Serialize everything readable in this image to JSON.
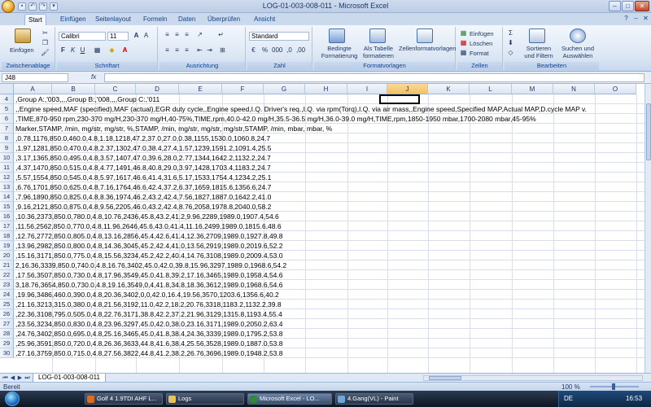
{
  "window": {
    "title": "LOG-01-003-008-011 - Microsoft Excel"
  },
  "tabs": [
    "Start",
    "Einfügen",
    "Seitenlayout",
    "Formeln",
    "Daten",
    "Überprüfen",
    "Ansicht"
  ],
  "ribbon": {
    "clipboard": {
      "label": "Zwischenablage",
      "paste": "Einfügen"
    },
    "font": {
      "label": "Schriftart",
      "name": "Calibri",
      "size": "11"
    },
    "alignment": {
      "label": "Ausrichtung"
    },
    "number": {
      "label": "Zahl",
      "format": "Standard"
    },
    "styles": {
      "label": "Formatvorlagen",
      "conditional": "Bedingte Formatierung",
      "as_table": "Als Tabelle formatieren",
      "cell_styles": "Zellenformatvorlagen"
    },
    "cells": {
      "label": "Zellen",
      "insert": "Einfügen",
      "delete": "Löschen",
      "format": "Format"
    },
    "editing": {
      "label": "Bearbeiten",
      "sort": "Sortieren und Filtern",
      "find": "Suchen und Auswählen"
    }
  },
  "formula_bar": {
    "name_box": "J48",
    "fx": "fx",
    "value": ""
  },
  "columns": [
    "A",
    "B",
    "C",
    "D",
    "E",
    "F",
    "G",
    "H",
    "I",
    "J",
    "K",
    "L",
    "M",
    "N",
    "O"
  ],
  "rows": [
    {
      "n": "4",
      "text": ",Group A:,'003,,,,Group B:,'008,,,,Group C:,'011"
    },
    {
      "n": "5",
      "text": ",,Engine speed,MAF (specified),MAF (actual),EGR duty cycle,,Engine speed,I.Q. Driver's req.,I.Q. via rpm(Torq),I.Q. via air mass,,Engine speed,Specified MAP,Actual MAP,D.cycle MAP v."
    },
    {
      "n": "6",
      "text": ",TIME,870-950 rpm,230-370 mg/H,230-370 mg/H,40-75%,TIME,rpm,40.0-42.0 mg/H,35.5-36.5 mg/H,36.0-39.0 mg/H,TIME,rpm,1850-1950 mbar,1700-2080 mbar,45-95%"
    },
    {
      "n": "7",
      "text": "Marker,STAMP, /min, mg/str, mg/str, %,STAMP, /min, mg/str, mg/str, mg/str,STAMP, /min, mbar, mbar, %"
    },
    {
      "n": "8",
      "text": ",0.78,1176,850.0,460.0,4.8,1.18,1218,47.2,37.0,27.0,0.38,1155,1530.0,1060.8,24.7"
    },
    {
      "n": "9",
      "text": ",1.97,1281,850.0,470.0,4.8,2.37,1302,47.0,38.4,27.4,1.57,1239,1591.2,1091.4,25.5"
    },
    {
      "n": "10",
      "text": ",3.17,1365,850.0,495.0,4.8,3.57,1407,47.0,39.6,28.0,2.77,1344,1642.2,1132.2,24.7"
    },
    {
      "n": "11",
      "text": ",4.37,1470,850.0,515.0,4.8,4.77,1491,46.8,40.8,29.0,3.97,1428,1703.4,1183.2,24.7"
    },
    {
      "n": "12",
      "text": ",5.57,1554,850.0,545.0,4.8,5.97,1617,46.6,41.4,31.6,5.17,1533,1754.4,1234.2,25.1"
    },
    {
      "n": "13",
      "text": ",6.76,1701,850.0,625.0,4.8,7.16,1764,46.6,42.4,37.2,6.37,1659,1815.6,1356.6,24.7"
    },
    {
      "n": "14",
      "text": ",7.96,1890,850.0,825.0,4.8,8.36,1974,46.2,43.2,42.4,7.56,1827,1887.0,1642.2,41.0"
    },
    {
      "n": "15",
      "text": ",9.16,2121,850.0,875.0,4.8,9.56,2205,46.0,43.2,42.4,8.76,2058,1978.8,2040.0,58.2"
    },
    {
      "n": "16",
      "text": ",10.36,2373,850.0,780.0,4.8,10.76,2436,45.8,43.2,41.2,9.96,2289,1989.0,1907.4,54.6"
    },
    {
      "n": "17",
      "text": ",11.56,2562,850.0,770.0,4.8,11.96,2646,45.6,43.0,41.4,11.16,2499,1989.0,1815.6,48.6"
    },
    {
      "n": "18",
      "text": ",12.76,2772,850.0,805.0,4.8,13.16,2856,45.4,42.6,41.4,12.36,2709,1989.0,1927.8,49.8"
    },
    {
      "n": "19",
      "text": ",13.96,2982,850.0,800.0,4.8,14.36,3045,45.2,42.4,41.0,13.56,2919,1989.0,2019.6,52.2"
    },
    {
      "n": "20",
      "text": ",15.16,3171,850.0,775.0,4.8,15.56,3234,45.2,42.2,40.4,14.76,3108,1989.0,2009.4,53.0"
    },
    {
      "n": "21",
      "text": "2,16.36,3339,850.0,740.0,4.8,16.76,3402,45.0,42.0,39.8,15.96,3297,1989.0,1968.6,54.2"
    },
    {
      "n": "22",
      "text": ",17.56,3507,850.0,730.0,4.8,17.96,3549,45.0,41.8,39.2,17.16,3465,1989.0,1958.4,54.6"
    },
    {
      "n": "23",
      "text": "3,18.76,3654,850.0,730.0,4.8,19.16,3549,0,4,41.8,34.8,18.36,3612,1989.0,1968.6,54.6"
    },
    {
      "n": "24",
      "text": ",19.96,3486,460.0,390.0,4.8,20.36,3402,0,0,42.0,16.4,19.56,3570,1203.6,1356.6,40.2"
    },
    {
      "n": "25",
      "text": ",21.16,3213,315.0,380.0,4.8,21.56,3192,11.0,42.2,18.2,20.76,3318,1183.2,1132.2,39.8"
    },
    {
      "n": "26",
      "text": ",22.36,3108,795.0,505.0,4.8,22.76,3171,38.8,42.2,37.2,21.96,3129,1315.8,1193.4,55.4"
    },
    {
      "n": "27",
      "text": ",23.56,3234,850.0,830.0,4.8,23.96,3297,45.0,42.0,38.0,23.16,3171,1989.0,2050.2,63.4"
    },
    {
      "n": "28",
      "text": ",24.76,3402,850.0,695.0,4.8,25.16,3465,45.0,41.8,38.4,24.36,3339,1989.0,1795.2,53.8"
    },
    {
      "n": "29",
      "text": ",25.96,3591,850.0,720.0,4.8,26.36,3633,44.8,41.6,38.4,25.56,3528,1989.0,1887.0,53.8"
    },
    {
      "n": "30",
      "text": ",27.16,3759,850.0,715.0,4.8,27.56,3822,44.8,41.2,38.2,26.76,3696,1989.0,1948.2,53.8"
    }
  ],
  "sheet": {
    "tab": "LOG-01-003-008-011"
  },
  "status": {
    "text": "Bereit",
    "zoom": "100 %"
  },
  "taskbar": {
    "tasks": [
      "Golf 4 1.9TDI AHF L...",
      "Logs",
      "Microsoft Excel - LO...",
      "4.Gang(VL) - Paint"
    ],
    "lang": "DE",
    "clock": "16:53"
  },
  "colors": {
    "accent": "#15428b",
    "selected_col": "#f1c15f"
  }
}
